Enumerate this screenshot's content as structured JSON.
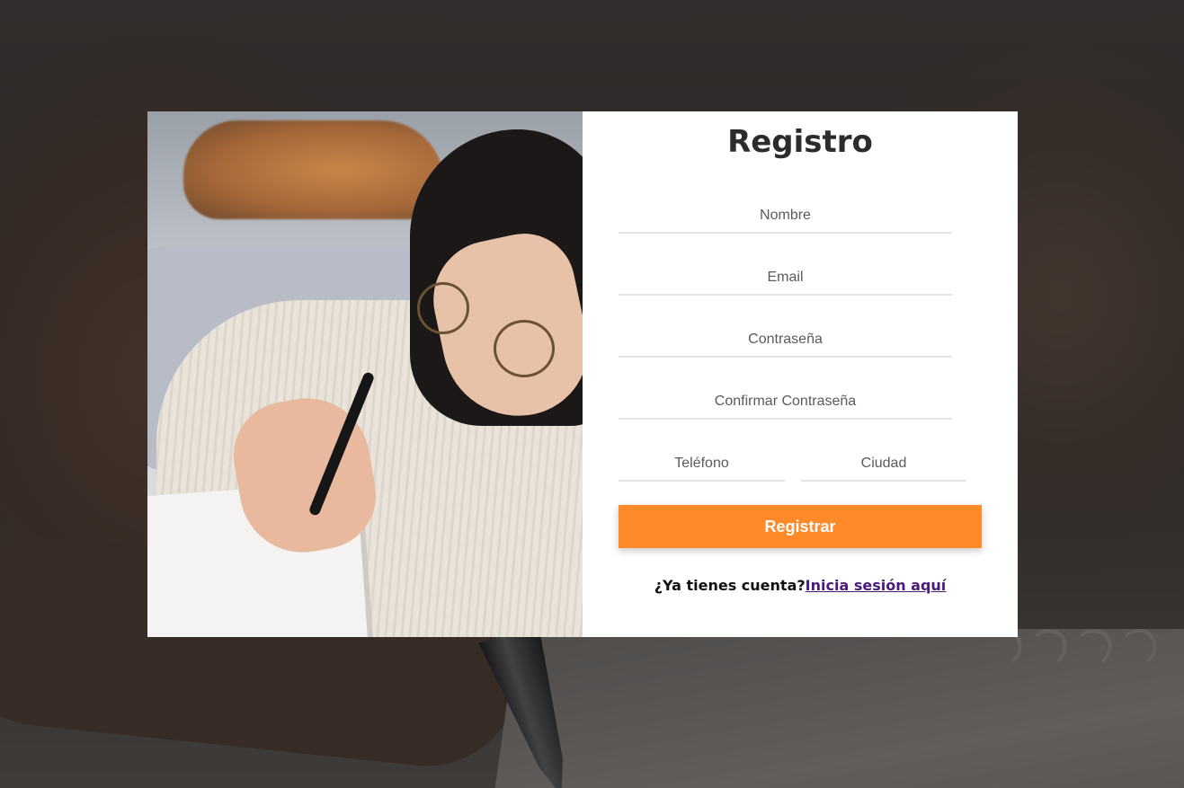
{
  "form": {
    "title": "Registro",
    "fields": {
      "nombre": "Nombre",
      "email": "Email",
      "password": "Contraseña",
      "confirm_password": "Confirmar Contraseña",
      "telefono": "Teléfono",
      "ciudad": "Ciudad"
    },
    "submit_label": "Registrar",
    "login_prompt": "¿Ya tienes cuenta?",
    "login_link": "Inicia sesión aquí"
  },
  "colors": {
    "accent": "#ff8a2a",
    "link": "#4b1a7a",
    "title": "#2c2c2c"
  },
  "images": {
    "background": "dimmed photo of a hand writing with a fountain pen on a spiral notebook",
    "side_photo": "woman with glasses in white sweater writing in notebook, dog sleeping in background"
  }
}
